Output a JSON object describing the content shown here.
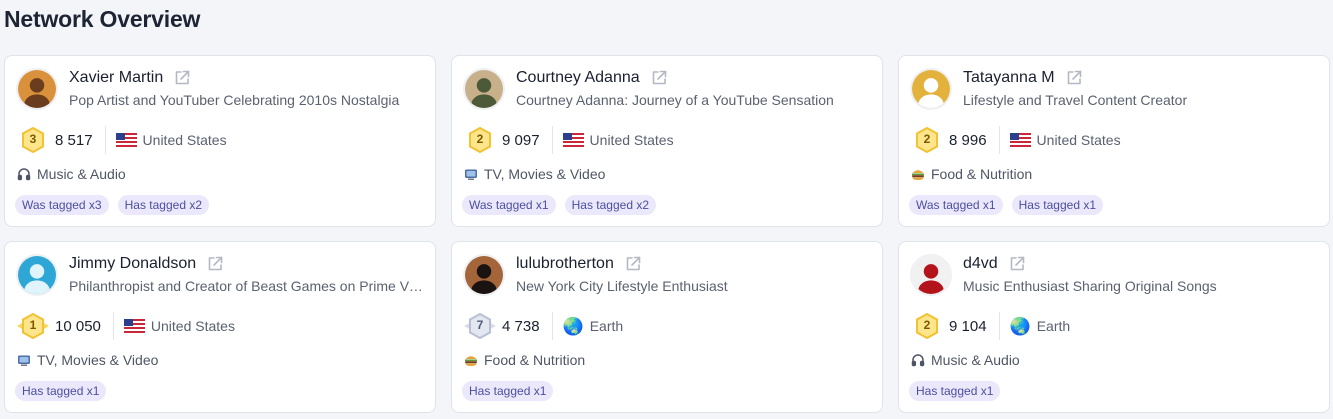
{
  "page": {
    "title": "Network Overview"
  },
  "cards": [
    {
      "name": "Xavier Martin",
      "description": "Pop Artist and YouTuber Celebrating 2010s Nostalgia",
      "rank": "3",
      "followers": "8 517",
      "country": "United States",
      "location_icon": "us-flag-icon",
      "category": "Music & Audio",
      "category_icon": "headphones-icon",
      "tags": [
        "Was tagged x3",
        "Has tagged x2"
      ],
      "avatar_colors": [
        "#6b3d1f",
        "#d9913c"
      ]
    },
    {
      "name": "Courtney Adanna",
      "description": "Courtney Adanna: Journey of a YouTube Sensation",
      "rank": "2",
      "followers": "9 097",
      "country": "United States",
      "location_icon": "us-flag-icon",
      "category": "TV, Movies & Video",
      "category_icon": "tv-icon",
      "tags": [
        "Was tagged x1",
        "Has tagged x2"
      ],
      "avatar_colors": [
        "#4d5a3a",
        "#c8b08a"
      ]
    },
    {
      "name": "Tatayanna M",
      "description": "Lifestyle and Travel Content Creator",
      "rank": "2",
      "followers": "8 996",
      "country": "United States",
      "location_icon": "us-flag-icon",
      "category": "Food & Nutrition",
      "category_icon": "burger-icon",
      "tags": [
        "Was tagged x1",
        "Has tagged x1"
      ],
      "avatar_colors": [
        "#ffffff",
        "#e3b23c"
      ]
    },
    {
      "name": "Jimmy Donaldson",
      "description": "Philanthropist and Creator of Beast Games on Prime Video",
      "rank": "1",
      "followers": "10 050",
      "country": "United States",
      "location_icon": "us-flag-icon",
      "category": "TV, Movies & Video",
      "category_icon": "tv-icon",
      "tags": [
        "Has tagged x1"
      ],
      "avatar_colors": [
        "#dff4fb",
        "#2fa7d6"
      ]
    },
    {
      "name": "lulubrotherton",
      "description": "New York City Lifestyle Enthusiast",
      "rank": "7",
      "followers": "4 738",
      "country": "Earth",
      "location_icon": "globe-icon",
      "category": "Food & Nutrition",
      "category_icon": "burger-icon",
      "tags": [
        "Has tagged x1"
      ],
      "avatar_colors": [
        "#1a1311",
        "#a4653a"
      ]
    },
    {
      "name": "d4vd",
      "description": "Music Enthusiast Sharing Original Songs",
      "rank": "2",
      "followers": "9 104",
      "country": "Earth",
      "location_icon": "globe-icon",
      "category": "Music & Audio",
      "category_icon": "headphones-icon",
      "tags": [
        "Has tagged x1"
      ],
      "avatar_colors": [
        "#b3141c",
        "#f1f1f1"
      ]
    }
  ],
  "colors": {
    "gold_badge": "#f6cf3f",
    "silver_badge": "#c9cfe0",
    "tag_bg": "#ece8fb",
    "tag_text": "#4b4fa0"
  }
}
